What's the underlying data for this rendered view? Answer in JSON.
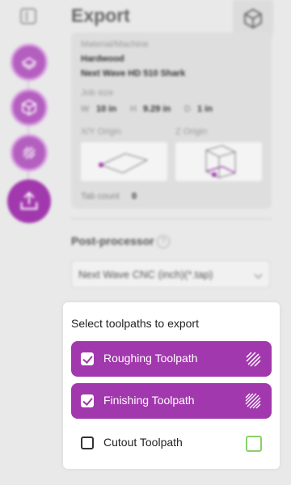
{
  "header": {
    "title": "Export"
  },
  "summary": {
    "material_machine_label": "Material/Machine",
    "material": "Hardwood",
    "machine": "Next Wave HD 510 Shark",
    "job_size_label": "Job size",
    "w_label": "W",
    "w_value": "10 in",
    "h_label": "H",
    "h_value": "9.29 in",
    "d_label": "D",
    "d_value": "1 in",
    "xy_origin_label": "X/Y Origin",
    "z_origin_label": "Z Origin",
    "tab_count_label": "Tab count",
    "tab_count_value": "0"
  },
  "post_processor": {
    "label": "Post-processor",
    "help": "?",
    "selected": "Next Wave CNC (inch)(*.tap)"
  },
  "toolpaths": {
    "heading": "Select toolpaths to export",
    "items": [
      {
        "label": "Roughing Toolpath",
        "checked": true,
        "icon": "roughing-icon"
      },
      {
        "label": "Finishing Toolpath",
        "checked": true,
        "icon": "finishing-icon"
      },
      {
        "label": "Cutout Toolpath",
        "checked": false,
        "icon": "cutout-icon"
      }
    ]
  },
  "steps": [
    "material-step-icon",
    "model-step-icon",
    "toolpath-step-icon",
    "export-step-icon"
  ],
  "colors": {
    "accent": "#a238ad",
    "accent_light": "#b45fbf",
    "cutout_green": "#8ad06a"
  }
}
